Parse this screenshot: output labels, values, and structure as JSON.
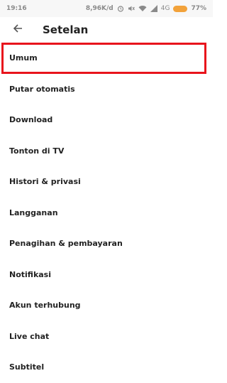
{
  "status_bar": {
    "time": "19:16",
    "speed": "8,96K/d",
    "network": "4G",
    "battery": "77%"
  },
  "header": {
    "title": "Setelan"
  },
  "menu": {
    "items": [
      {
        "label": "Umum"
      },
      {
        "label": "Putar otomatis"
      },
      {
        "label": "Download"
      },
      {
        "label": "Tonton di TV"
      },
      {
        "label": "Histori & privasi"
      },
      {
        "label": "Langganan"
      },
      {
        "label": "Penagihan & pembayaran"
      },
      {
        "label": "Notifikasi"
      },
      {
        "label": "Akun terhubung"
      },
      {
        "label": "Live chat"
      },
      {
        "label": "Subtitel"
      }
    ]
  },
  "highlight_color": "#e8141c"
}
